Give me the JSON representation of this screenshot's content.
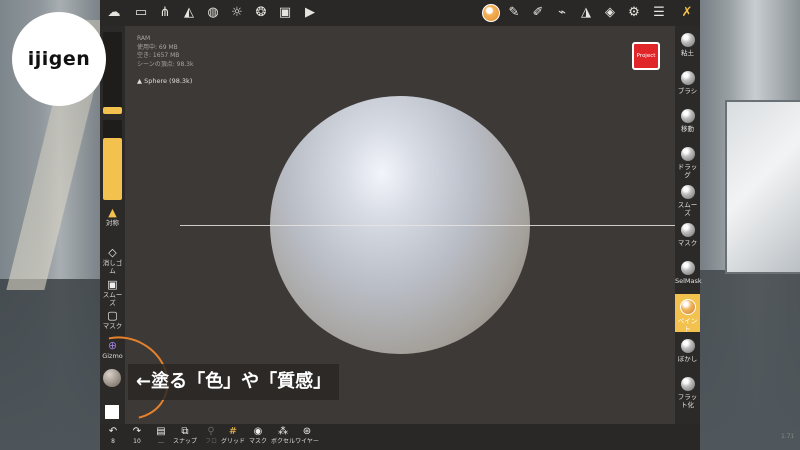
{
  "logo": {
    "text": "ijigen"
  },
  "top_toolbar": {
    "icons": [
      "nomad-logo-icon",
      "folder-icon",
      "scene-graph-icon",
      "topology-icon",
      "material-icon",
      "light-icon",
      "postprocess-icon",
      "background-image-icon",
      "camera-icon",
      "paint-color-icon",
      "pen-icon",
      "picker-icon",
      "stroke-icon",
      "symmetry-icon",
      "layers-icon",
      "settings-icon",
      "sliders-icon",
      "tools-icon"
    ]
  },
  "info": {
    "title": "RAM",
    "used": "使用中: 69 MB",
    "free": "空き: 1657 MB",
    "vertices": "シーンの頂点: 98.3k",
    "mesh_name": "Sphere (98.3k)"
  },
  "project_button": "Project",
  "left_sidebar": {
    "radius_level": 0.08,
    "intensity_level": 0.78,
    "items": [
      {
        "label": "対称",
        "icon": "symmetry-icon"
      },
      {
        "label": "消しゴム",
        "icon": "eraser-icon"
      },
      {
        "label": "スムーズ",
        "icon": "smooth-icon"
      },
      {
        "label": "マスク",
        "icon": "mask-icon"
      },
      {
        "label": "Gizmo",
        "icon": "gizmo-icon"
      }
    ]
  },
  "right_sidebar": {
    "items": [
      {
        "label": "粘土"
      },
      {
        "label": "ブラシ"
      },
      {
        "label": "移動"
      },
      {
        "label": "ドラッグ"
      },
      {
        "label": "スムーズ"
      },
      {
        "label": "マスク"
      },
      {
        "label": "SelMask"
      },
      {
        "label": "ペイント",
        "active": true
      },
      {
        "label": "ぼかし"
      },
      {
        "label": "フラット化"
      }
    ]
  },
  "bottom_toolbar": {
    "items": [
      {
        "label": "8",
        "icon": "undo-icon"
      },
      {
        "label": "10",
        "icon": "redo-icon"
      },
      {
        "label": "...",
        "icon": "more-icon"
      },
      {
        "label": "スナップ",
        "icon": "snapshot-icon"
      },
      {
        "label": "フロ",
        "icon": "focus-icon"
      },
      {
        "label": "グリッド",
        "icon": "grid-icon"
      },
      {
        "label": "マスク",
        "icon": "mask-visibility-icon"
      },
      {
        "label": "ボクセル",
        "icon": "voxel-icon"
      },
      {
        "label": "ワイヤー",
        "icon": "wireframe-icon"
      }
    ]
  },
  "callout": {
    "text": "←塗る「色」や「質感」"
  },
  "corner_value": "1.71",
  "colors": {
    "accent": "#f2c14e",
    "project": "#e1262a",
    "ring": "#e6812c"
  }
}
